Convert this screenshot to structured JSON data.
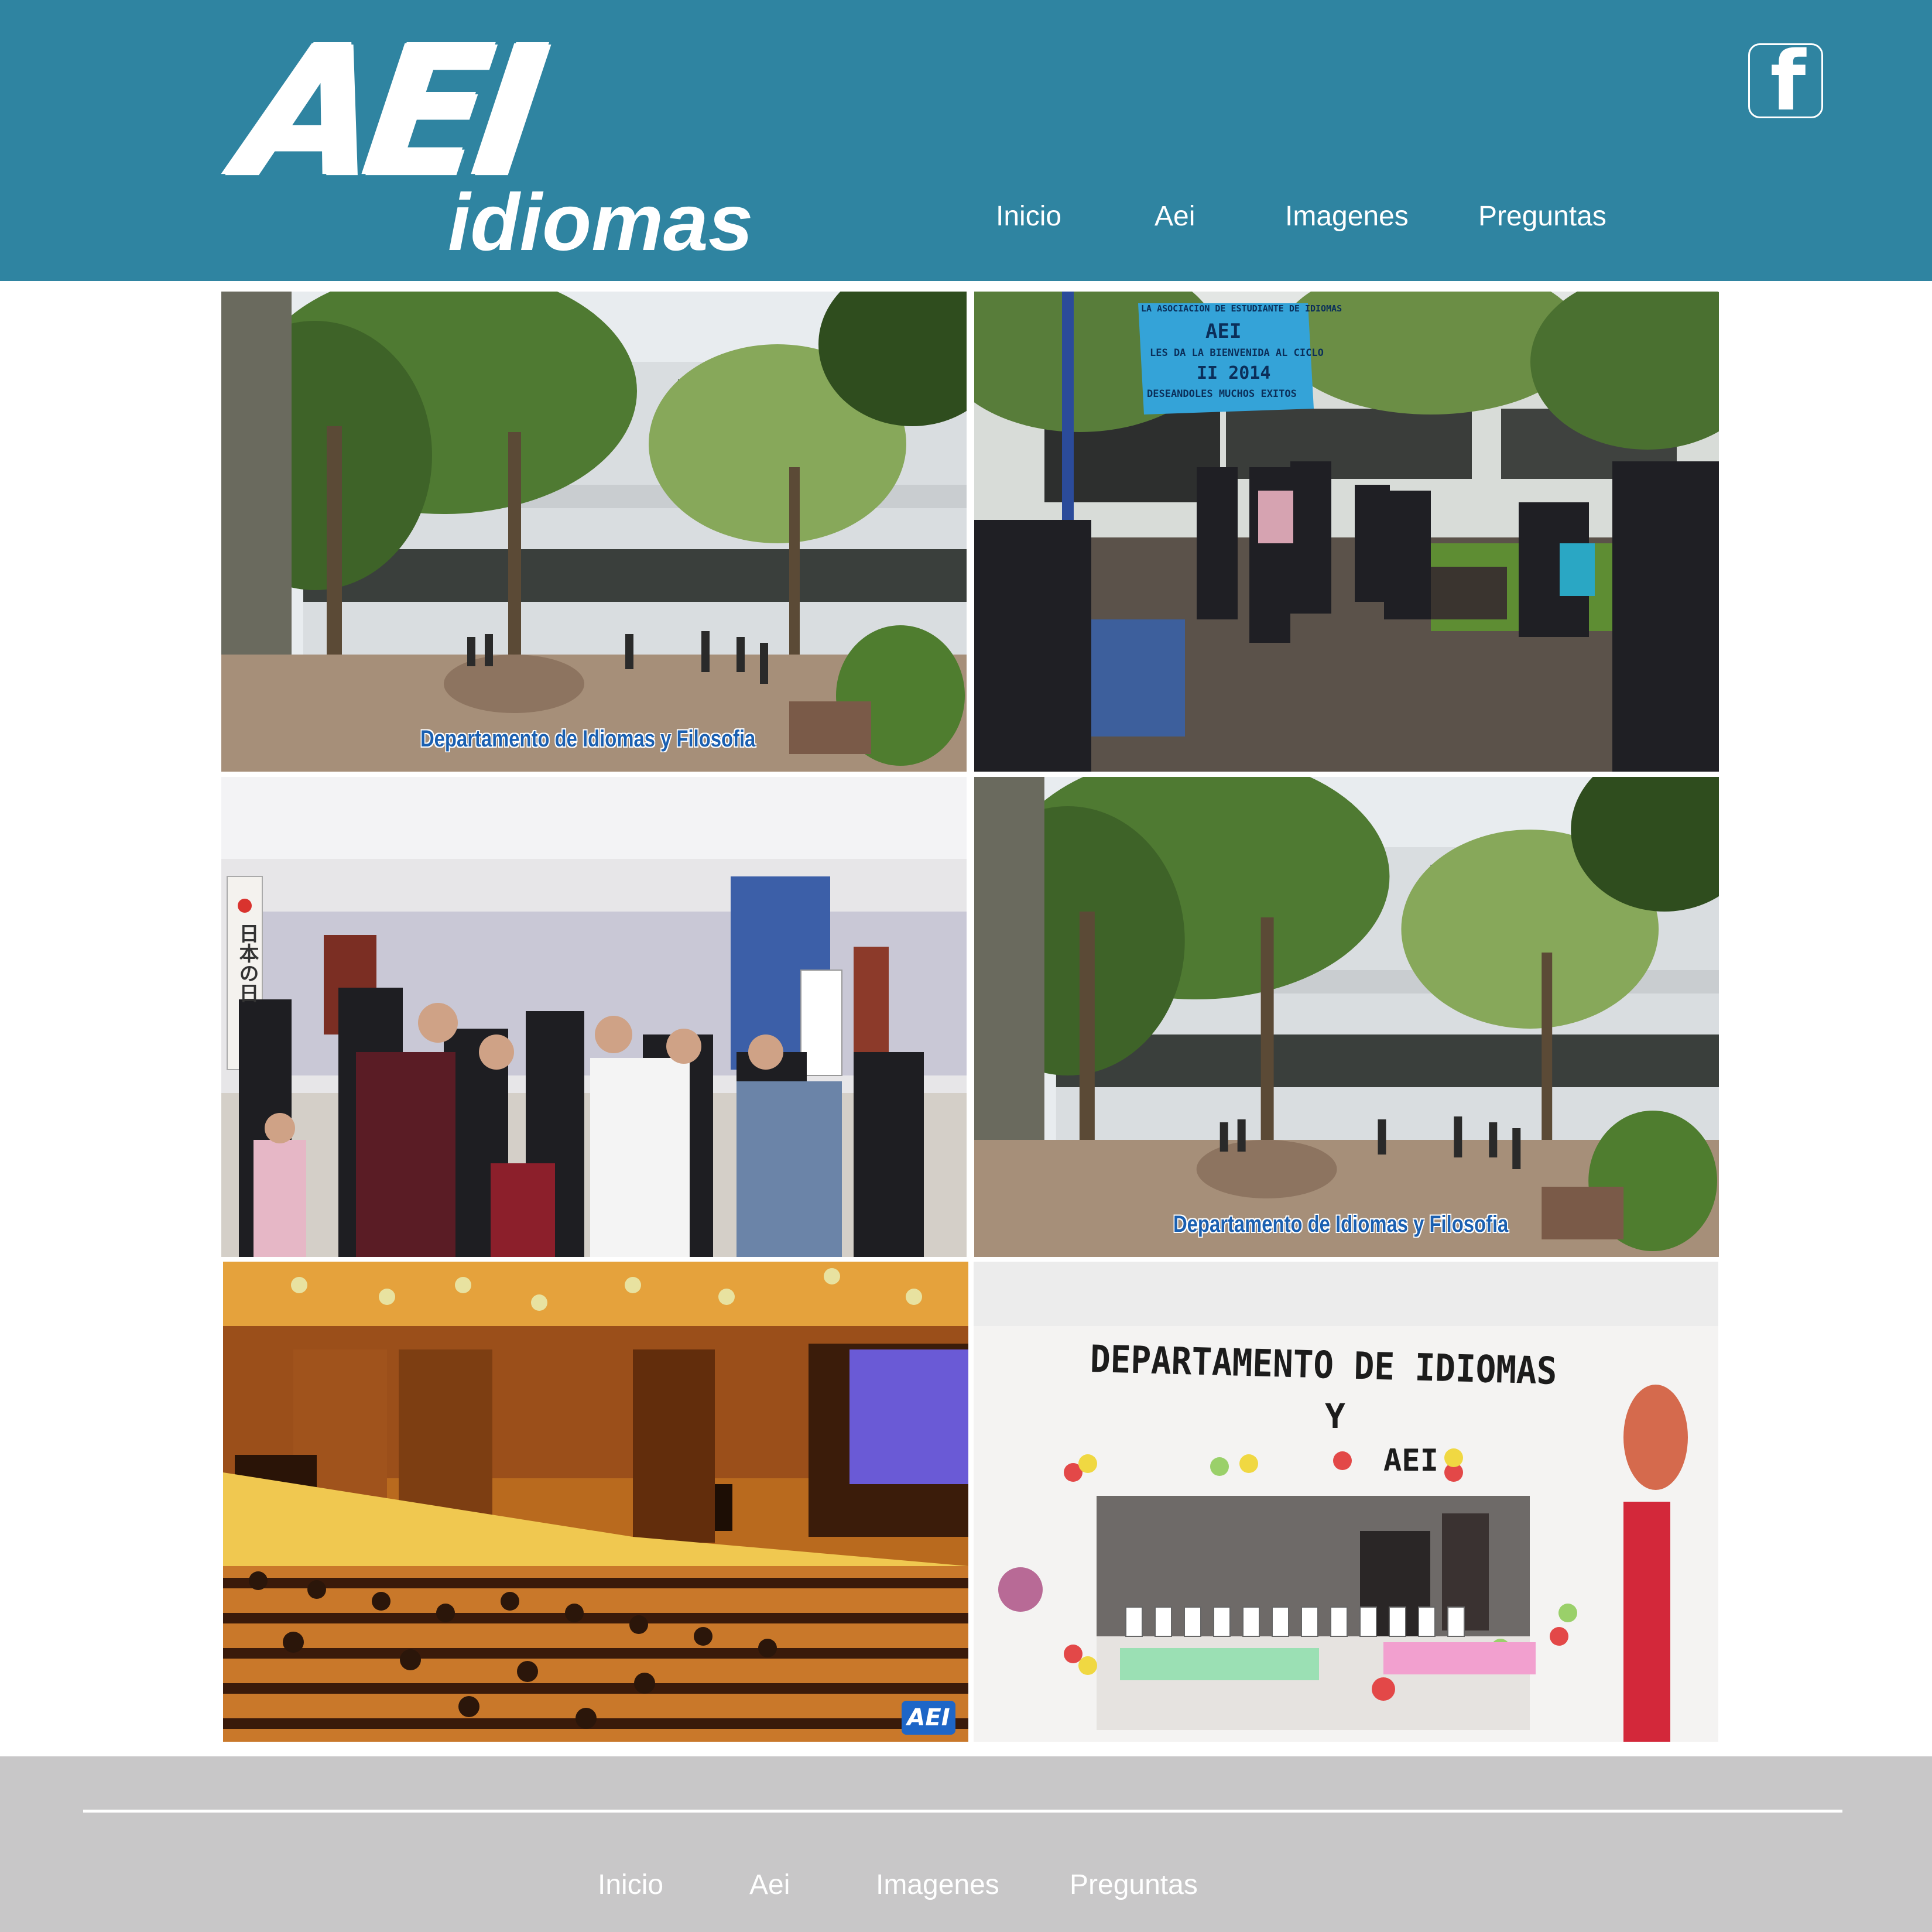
{
  "header": {
    "logo": {
      "mark": "AEI",
      "subtitle": "idiomas"
    },
    "social": {
      "icon": "facebook-icon",
      "glyph": "f"
    },
    "nav": [
      "Inicio",
      "Aei",
      "Imagenes",
      "Preguntas"
    ]
  },
  "gallery": {
    "photo1": {
      "caption": "Departamento de Idiomas y Filosofia"
    },
    "photo2": {
      "banner": [
        "LA ASOCIACION DE ESTUDIANTE DE IDIOMAS",
        "AEI",
        "LES DA LA BIENVENIDA AL CICLO",
        "II 2014",
        "DESEANDOLES MUCHOS EXITOS"
      ]
    },
    "photo3": {
      "sign": "日本の日"
    },
    "photo4": {
      "caption": "Departamento de Idiomas y Filosofia"
    },
    "photo5": {
      "badge": "AEI"
    },
    "photo6": {
      "wall": [
        "DEPARTAMENTO DE IDIOMAS",
        "Y",
        "AEI"
      ]
    }
  },
  "footer": {
    "nav": [
      "Inicio",
      "Aei",
      "Imagenes",
      "Preguntas"
    ]
  },
  "colors": {
    "header_bg": "#2f84a1",
    "footer_bg": "#c8c7c8",
    "text_light": "#ffffff",
    "caption_blue": "#1a5fb0"
  }
}
